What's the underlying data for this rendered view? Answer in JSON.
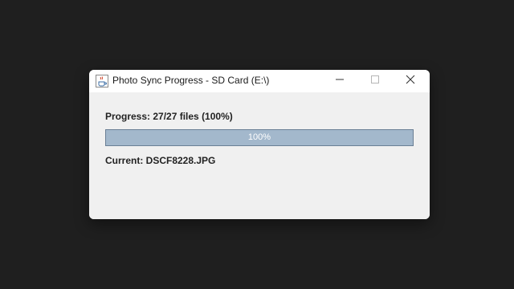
{
  "window": {
    "title": "Photo Sync Progress - SD Card (E:\\)",
    "app_icon": "java-cup-icon",
    "controls": {
      "minimize_icon": "minimize-icon",
      "maximize_icon": "maximize-icon",
      "close_icon": "close-icon"
    }
  },
  "progress": {
    "label": "Progress: 27/27 files (100%)",
    "bar_text": "100%",
    "fraction": 1.0,
    "fill_color": "#a3b8cc",
    "border_color": "#6a7f95"
  },
  "current": {
    "label": "Current: DSCF8228.JPG"
  },
  "colors": {
    "desktop_background": "#1f1f1f",
    "window_background": "#f0f0f0",
    "titlebar_background": "#ffffff"
  }
}
